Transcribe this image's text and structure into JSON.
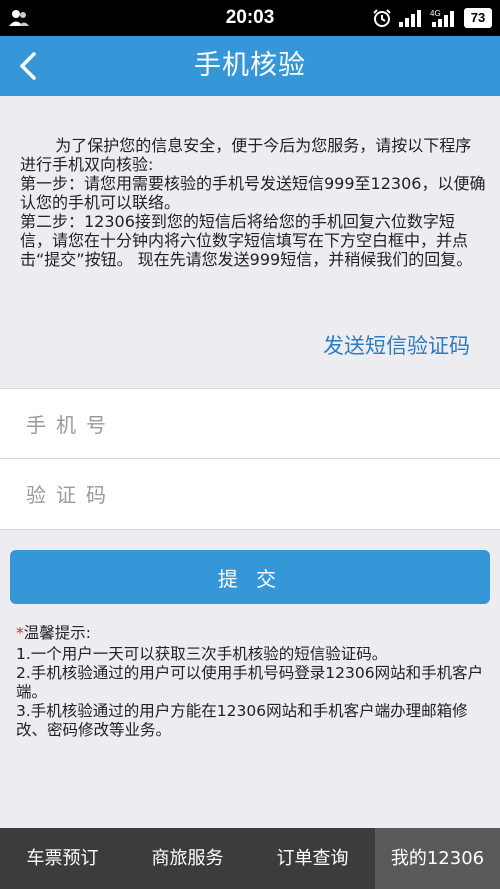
{
  "status_bar": {
    "time": "20:03",
    "battery": "73",
    "icons": [
      "contacts-icon",
      "alarm-icon",
      "signal-icon",
      "network-4g-icon",
      "battery-icon"
    ]
  },
  "header": {
    "title": "手机核验",
    "back_icon": "chevron-left-icon"
  },
  "intro": {
    "line1": "为了保护您的信息安全，便于今后为您服务，请按以下程序进行手机双向核验:",
    "step1": "第一步：请您用需要核验的手机号发送短信999至12306，以便确认您的手机可以联络。",
    "step2": "第二步：12306接到您的短信后将给您的手机回复六位数字短信，请您在十分钟内将六位数字短信填写在下方空白框中，并点击“提交”按钮。 现在先请您发送999短信，并稍候我们的回复。"
  },
  "send_sms_link": "发送短信验证码",
  "form": {
    "phone_placeholder": "手机号",
    "code_placeholder": "验证码",
    "submit_label": "提 交"
  },
  "tips": {
    "star": "*",
    "title": "温馨提示:",
    "items": [
      "1.一个用户一天可以获取三次手机核验的短信验证码。",
      "2.手机核验通过的用户可以使用手机号码登录12306网站和手机客户端。",
      "3.手机核验通过的用户方能在12306网站和手机客户端办理邮箱修改、密码修改等业务。"
    ]
  },
  "bottom_nav": [
    {
      "label": "车票预订"
    },
    {
      "label": "商旅服务"
    },
    {
      "label": "订单查询"
    },
    {
      "label": "我的12306"
    }
  ],
  "colors": {
    "primary": "#3596d8",
    "link": "#2d7cc0",
    "nav_bg": "#3c3c3c",
    "nav_active": "#5a5a5a",
    "star": "#d9262c"
  }
}
